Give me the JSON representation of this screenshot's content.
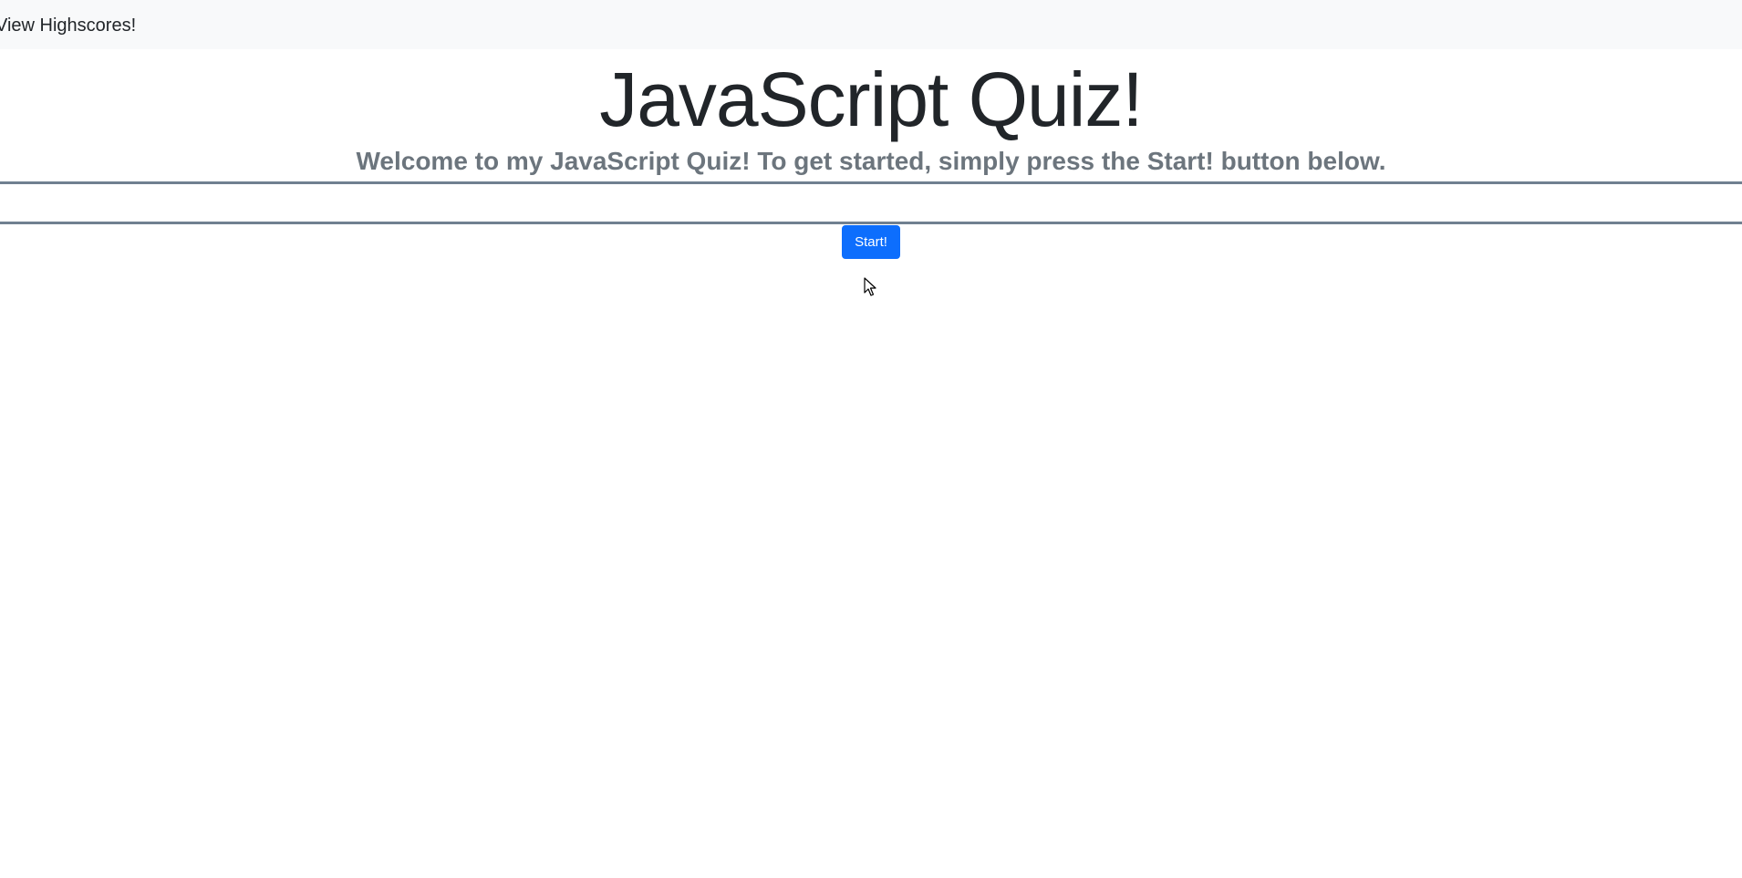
{
  "navbar": {
    "highscores_label": "View Highscores!"
  },
  "header": {
    "title": "JavaScript Quiz!",
    "subtitle": "Welcome to my JavaScript Quiz! To get started, simply press the Start! button below."
  },
  "quiz": {
    "question_text": ""
  },
  "actions": {
    "start_label": "Start!"
  },
  "colors": {
    "accent": "#0d6efd",
    "navbar_bg": "#f8f9fa",
    "subtitle": "#6c757d",
    "rule": "#708090"
  },
  "icons": {
    "cursor": "mouse-pointer-icon"
  }
}
